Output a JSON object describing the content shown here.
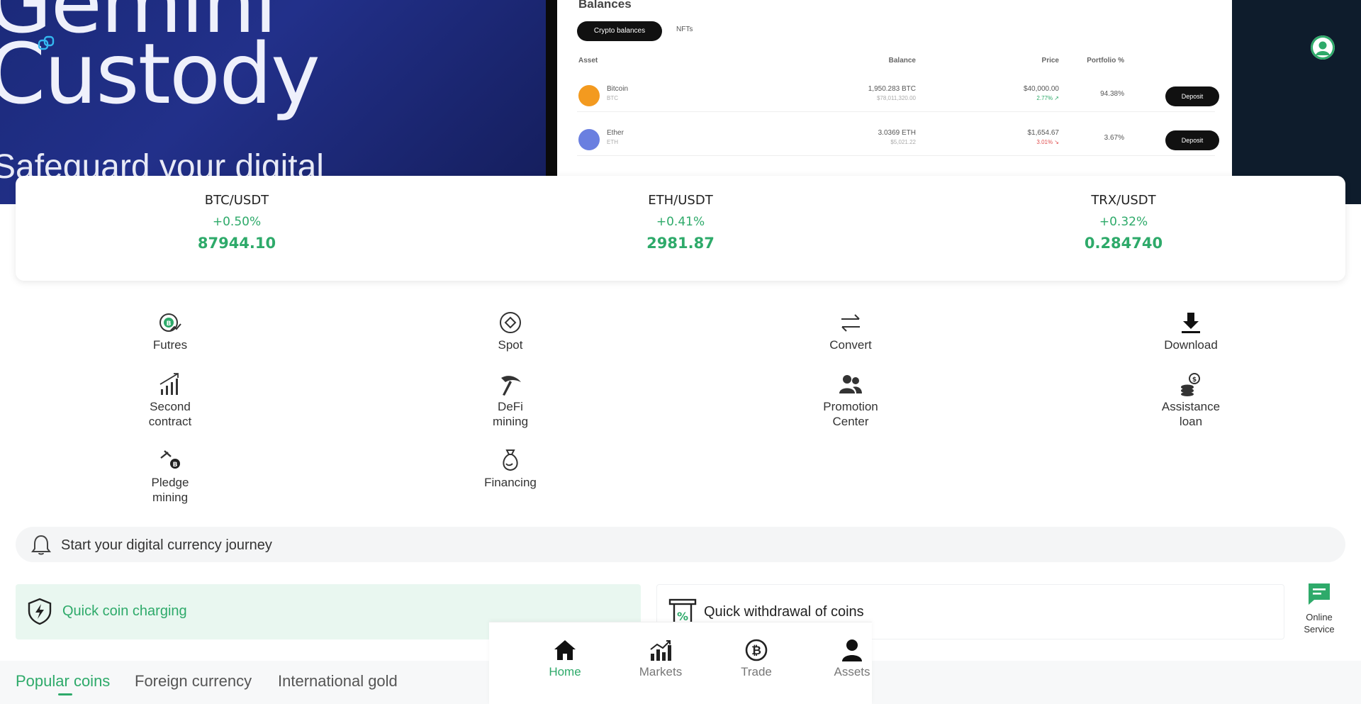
{
  "banner": {
    "headline": "Gemini\nCustody",
    "subtitle": "Safeguard your digital",
    "mock": {
      "title": "Balances",
      "tab_active": "Crypto balances",
      "tab_other": "NFTs",
      "headers": {
        "asset": "Asset",
        "balance": "Balance",
        "price": "Price",
        "portfolio": "Portfolio %"
      },
      "rows": [
        {
          "name": "Bitcoin",
          "symbol": "BTC",
          "balance": "1,950.283 BTC",
          "balance_usd": "$78,011,320.00",
          "price": "$40,000.00",
          "change": "2.77% ↗",
          "portfolio": "94.38%",
          "action": "Deposit",
          "color": "#f39a1f",
          "direction": "up"
        },
        {
          "name": "Ether",
          "symbol": "ETH",
          "balance": "3.0369 ETH",
          "balance_usd": "$5,021.22",
          "price": "$1,654.67",
          "change": "3.01% ↘",
          "portfolio": "3.67%",
          "action": "Deposit",
          "color": "#6a7fe0",
          "direction": "down"
        }
      ]
    }
  },
  "tickers": [
    {
      "pair": "BTC/USDT",
      "change": "+0.50%",
      "price": "87944.10"
    },
    {
      "pair": "ETH/USDT",
      "change": "+0.41%",
      "price": "2981.87"
    },
    {
      "pair": "TRX/USDT",
      "change": "+0.32%",
      "price": "0.284740"
    }
  ],
  "menu": [
    {
      "label": "Futres",
      "icon": "futures-coin-icon"
    },
    {
      "label": "Spot",
      "icon": "spot-diamond-icon"
    },
    {
      "label": "Convert",
      "icon": "convert-arrows-icon"
    },
    {
      "label": "Download",
      "icon": "download-icon"
    },
    {
      "label": "Second\ncontract",
      "icon": "signal-bars-icon"
    },
    {
      "label": "DeFi\nmining",
      "icon": "pickaxe-icon"
    },
    {
      "label": "Promotion\nCenter",
      "icon": "users-icon"
    },
    {
      "label": "Assistance\nloan",
      "icon": "coins-stack-icon"
    },
    {
      "label": "Pledge\nmining",
      "icon": "pledge-pick-icon"
    },
    {
      "label": "Financing",
      "icon": "money-bag-icon"
    }
  ],
  "notice": {
    "text": "Start your digital currency journey"
  },
  "quick": {
    "charge": "Quick coin charging",
    "withdraw": "Quick withdrawal of coins"
  },
  "service": {
    "label": "Online\nService"
  },
  "coin_tabs": [
    "Popular coins",
    "Foreign currency",
    "International gold"
  ],
  "nav": [
    {
      "label": "Home",
      "active": true
    },
    {
      "label": "Markets",
      "active": false
    },
    {
      "label": "Trade",
      "active": false
    },
    {
      "label": "Assets",
      "active": false
    }
  ],
  "colors": {
    "accent": "#2eaa6a",
    "banner_blue": "#1b2a7a",
    "dark": "#111111"
  }
}
